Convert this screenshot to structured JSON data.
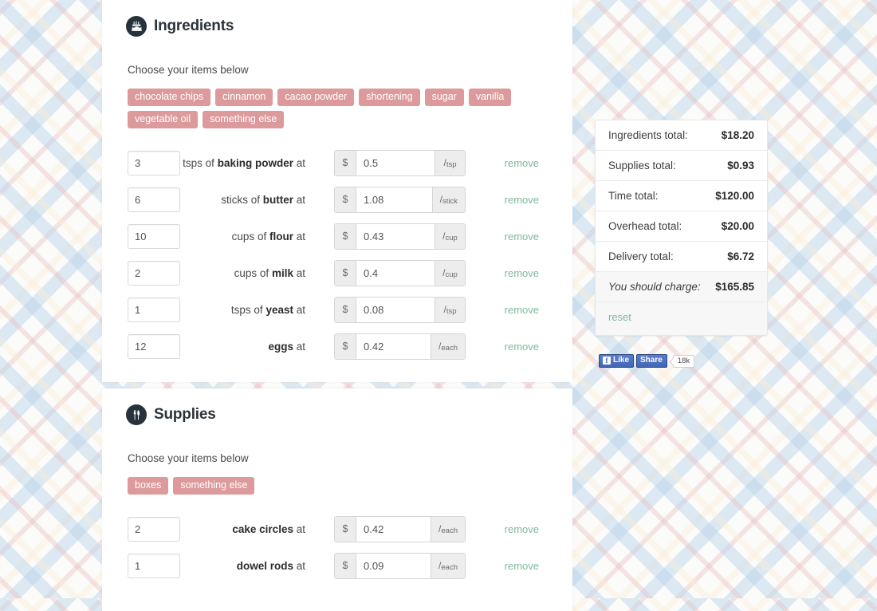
{
  "theme": {
    "tag_color": "#dd9a9c",
    "link_color": "#7fb89c",
    "icon_bg": "#27323c",
    "accent_blue": "#4267b2"
  },
  "sections": [
    {
      "id": "ingredients",
      "title": "Ingredients",
      "icon": "cake-icon",
      "choose_label": "Choose your items below",
      "tags": [
        "chocolate chips",
        "cinnamon",
        "cacao powder",
        "shortening",
        "sugar",
        "vanilla",
        "vegetable oil",
        "something else"
      ],
      "rows": [
        {
          "qty": "3",
          "unit_prefix": "tsps of",
          "name": "baking powder",
          "suffix": "at",
          "currency": "$",
          "price": "0.5",
          "per": "each",
          "unit": "tsp",
          "remove_label": "remove"
        },
        {
          "qty": "6",
          "unit_prefix": "sticks of",
          "name": "butter",
          "suffix": "at",
          "currency": "$",
          "price": "1.08",
          "per": "each",
          "unit": "stick",
          "remove_label": "remove"
        },
        {
          "qty": "10",
          "unit_prefix": "cups of",
          "name": "flour",
          "suffix": "at",
          "currency": "$",
          "price": "0.43",
          "per": "each",
          "unit": "cup",
          "remove_label": "remove"
        },
        {
          "qty": "2",
          "unit_prefix": "cups of",
          "name": "milk",
          "suffix": "at",
          "currency": "$",
          "price": "0.4",
          "per": "each",
          "unit": "cup",
          "remove_label": "remove"
        },
        {
          "qty": "1",
          "unit_prefix": "tsps of",
          "name": "yeast",
          "suffix": "at",
          "currency": "$",
          "price": "0.08",
          "per": "each",
          "unit": "tsp",
          "remove_label": "remove"
        },
        {
          "qty": "12",
          "unit_prefix": "",
          "name": "eggs",
          "suffix": "at",
          "currency": "$",
          "price": "0.42",
          "per": "each",
          "unit": "each",
          "remove_label": "remove"
        }
      ]
    },
    {
      "id": "supplies",
      "title": "Supplies",
      "icon": "fork-knife-icon",
      "choose_label": "Choose your items below",
      "tags": [
        "boxes",
        "something else"
      ],
      "rows": [
        {
          "qty": "2",
          "unit_prefix": "",
          "name": "cake circles",
          "suffix": "at",
          "currency": "$",
          "price": "0.42",
          "per": "each",
          "unit": "each",
          "remove_label": "remove"
        },
        {
          "qty": "1",
          "unit_prefix": "",
          "name": "dowel rods",
          "suffix": "at",
          "currency": "$",
          "price": "0.09",
          "per": "each",
          "unit": "each",
          "remove_label": "remove"
        }
      ]
    }
  ],
  "totals": {
    "rows": [
      {
        "label": "Ingredients total:",
        "value": "$18.20"
      },
      {
        "label": "Supplies total:",
        "value": "$0.93"
      },
      {
        "label": "Time total:",
        "value": "$120.00"
      },
      {
        "label": "Overhead total:",
        "value": "$20.00"
      },
      {
        "label": "Delivery total:",
        "value": "$6.72"
      }
    ],
    "final": {
      "label": "You should charge:",
      "value": "$165.85"
    },
    "reset_label": "reset"
  },
  "facebook": {
    "like_label": "Like",
    "share_label": "Share",
    "count": "18k",
    "f_glyph": "f"
  }
}
